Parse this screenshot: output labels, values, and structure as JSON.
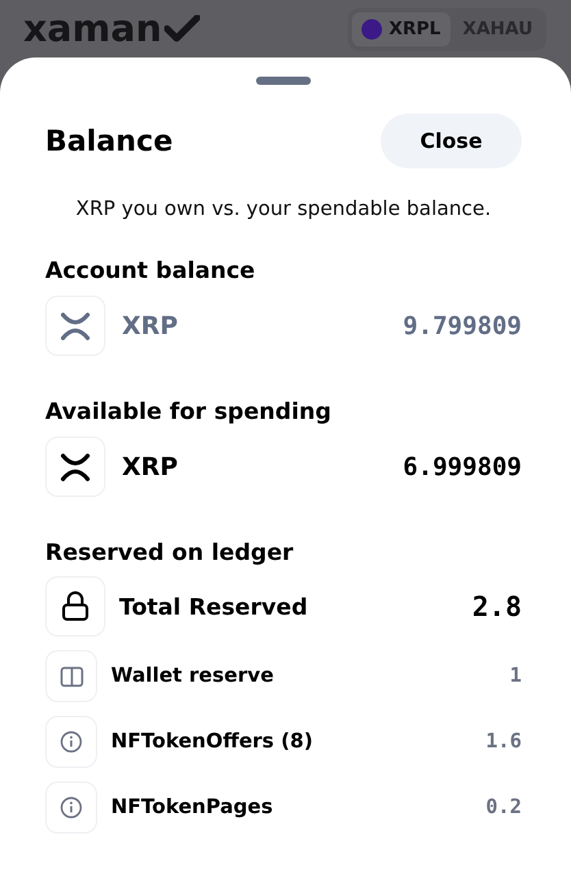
{
  "header": {
    "logo": "xaman",
    "networks": [
      {
        "label": "XRPL",
        "selected": true,
        "color": "#3b1a87"
      },
      {
        "label": "XAHAU",
        "selected": false
      }
    ]
  },
  "sheet": {
    "title": "Balance",
    "close_button": "Close",
    "subtitle": "XRP you own vs. your spendable balance.",
    "sections": [
      {
        "heading": "Account balance",
        "rows": [
          {
            "kind": "muted",
            "label": "XRP",
            "value": "9.799809"
          }
        ]
      },
      {
        "heading": "Available for spending",
        "rows": [
          {
            "kind": "primary",
            "label": "XRP",
            "value": "6.999809"
          }
        ]
      },
      {
        "heading": "Reserved on ledger",
        "rows": [
          {
            "kind": "total",
            "label": "Total Reserved",
            "value": "2.8"
          },
          {
            "kind": "reserve",
            "label": "Wallet reserve",
            "value": "1"
          },
          {
            "kind": "object",
            "label": "NFTokenOffers (8)",
            "value": "1.6"
          },
          {
            "kind": "object",
            "label": "NFTokenPages",
            "value": "0.2"
          }
        ]
      }
    ]
  }
}
